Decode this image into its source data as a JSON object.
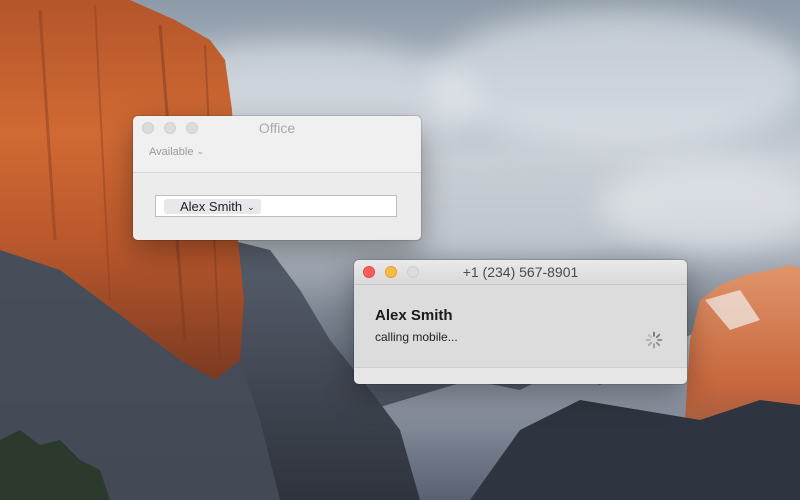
{
  "office_window": {
    "title": "Office",
    "status_label": "Available",
    "contact_token": "Alex Smith"
  },
  "call_window": {
    "title": "+1 (234) 567-8901",
    "caller_name": "Alex Smith",
    "status_text": "calling mobile..."
  },
  "colors": {
    "close": "#fc605c",
    "minimize": "#fdbc40",
    "inactive_button": "#dcdcdc"
  },
  "icons": {
    "status_dropdown": "chevron-down-icon",
    "contact_dropdown": "chevron-down-icon",
    "activity": "spinner-icon"
  }
}
